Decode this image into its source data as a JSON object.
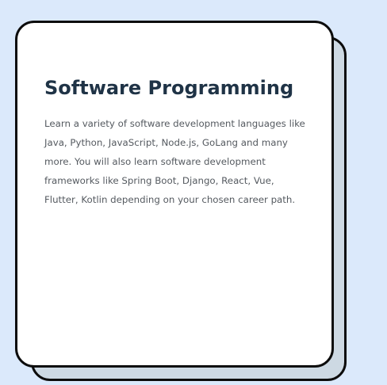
{
  "card": {
    "title": "Software Programming",
    "description": "Learn a variety of software development languages like Java, Python, JavaScript, Node.js, GoLang and many more. You will also learn software development frameworks like Spring Boot, Django, React, Vue, Flutter, Kotlin depending on your chosen career path."
  },
  "colors": {
    "page_background": "#dbe9fb",
    "card_background": "#ffffff",
    "card_shadow": "#cdd9e3",
    "card_border": "#0c0c0c",
    "title_color": "#1f3346",
    "body_color": "#555a60"
  }
}
